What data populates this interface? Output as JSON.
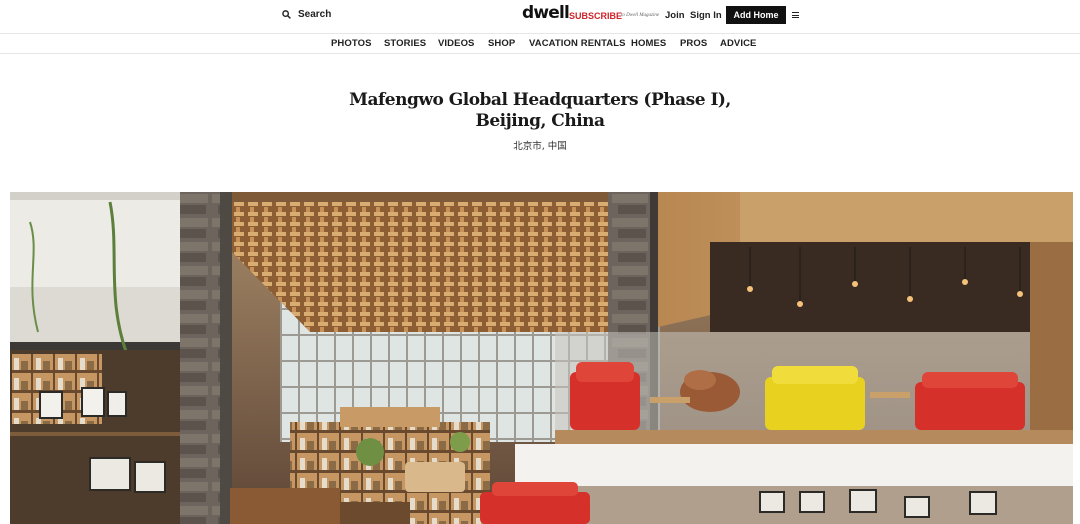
{
  "header": {
    "search_label": "Search",
    "logo": "dwell",
    "subscribe_label": "SUBSCRIBE",
    "subscribe_sub": "to Dwell Magazine",
    "join_label": "Join",
    "signin_label": "Sign In",
    "addhome_label": "Add Home"
  },
  "nav": {
    "items": [
      {
        "label": "PHOTOS"
      },
      {
        "label": "STORIES"
      },
      {
        "label": "VIDEOS"
      },
      {
        "label": "SHOP"
      },
      {
        "label": "VACATION RENTALS"
      },
      {
        "label": "HOMES"
      },
      {
        "label": "PROS"
      },
      {
        "label": "ADVICE"
      }
    ]
  },
  "article": {
    "title_line1": "Mafengwo Global Headquarters (Phase I),",
    "title_line2": "Beijing, China",
    "location": "北京市, 中国"
  },
  "colors": {
    "subscribe": "#d0232a",
    "button_bg": "#111111",
    "wood": "#c99a62",
    "chair_red": "#d6302a",
    "chair_yellow": "#e8d21f"
  },
  "icons": {
    "search": "search-icon",
    "menu": "hamburger-menu-icon"
  }
}
